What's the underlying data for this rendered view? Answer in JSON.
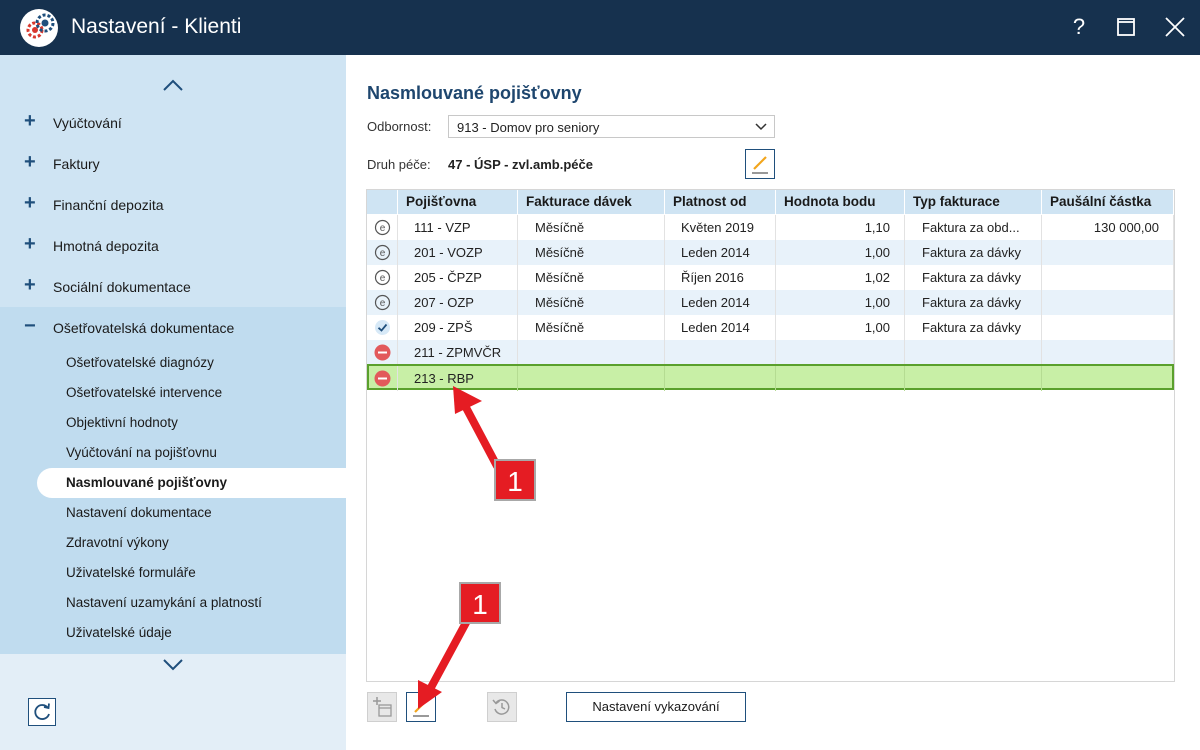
{
  "window": {
    "title": "Nastavení - Klienti",
    "help": "?",
    "colors": {
      "titlebar": "#16314e",
      "sidebar": "#cfe4f3",
      "accent": "#1f4f7c",
      "selected_row": "#c8efa6"
    }
  },
  "sidebar": {
    "top_items": [
      {
        "label": "Vyúčtování",
        "icon": "plus-icon"
      },
      {
        "label": "Faktury",
        "icon": "plus-icon"
      },
      {
        "label": "Finanční depozita",
        "icon": "plus-icon"
      },
      {
        "label": "Hmotná depozita",
        "icon": "plus-icon"
      },
      {
        "label": "Sociální dokumentace",
        "icon": "plus-icon"
      }
    ],
    "open_item": {
      "label": "Ošetřovatelská dokumentace",
      "icon": "minus-icon"
    },
    "sub_items": [
      {
        "label": "Ošetřovatelské diagnózy"
      },
      {
        "label": "Ošetřovatelské intervence"
      },
      {
        "label": "Objektivní hodnoty"
      },
      {
        "label": "Vyúčtování na pojišťovnu"
      },
      {
        "label": "Nasmlouvané pojišťovny",
        "active": true
      },
      {
        "label": "Nastavení dokumentace"
      },
      {
        "label": "Zdravotní výkony"
      },
      {
        "label": "Uživatelské formuláře"
      },
      {
        "label": "Nastavení uzamykání a platností"
      },
      {
        "label": "Uživatelské údaje"
      }
    ]
  },
  "main": {
    "heading": "Nasmlouvané pojišťovny",
    "odbornost_label": "Odbornost:",
    "odbornost_value": "913 - Domov pro seniory",
    "druh_label": "Druh péče:",
    "druh_value": "47 - ÚSP - zvl.amb.péče",
    "table": {
      "columns": [
        "Pojišťovna",
        "Fakturace dávek",
        "Platnost od",
        "Hodnota bodu",
        "Typ fakturace",
        "Paušální částka"
      ],
      "rows": [
        {
          "status": "e-icon",
          "pojistovna": "111 - VZP",
          "fakturace": "Měsíčně",
          "platnost": "Květen 2019",
          "hodnota": "1,10",
          "typ": "Faktura za obd...",
          "pausal": "130 000,00"
        },
        {
          "status": "e-icon",
          "pojistovna": "201 - VOZP",
          "fakturace": "Měsíčně",
          "platnost": "Leden 2014",
          "hodnota": "1,00",
          "typ": "Faktura za dávky",
          "pausal": ""
        },
        {
          "status": "e-icon",
          "pojistovna": "205 - ČPZP",
          "fakturace": "Měsíčně",
          "platnost": "Říjen 2016",
          "hodnota": "1,02",
          "typ": "Faktura za dávky",
          "pausal": ""
        },
        {
          "status": "e-icon",
          "pojistovna": "207 - OZP",
          "fakturace": "Měsíčně",
          "platnost": "Leden 2014",
          "hodnota": "1,00",
          "typ": "Faktura za dávky",
          "pausal": ""
        },
        {
          "status": "check-icon",
          "pojistovna": "209 - ZPŠ",
          "fakturace": "Měsíčně",
          "platnost": "Leden 2014",
          "hodnota": "1,00",
          "typ": "Faktura za dávky",
          "pausal": ""
        },
        {
          "status": "minus-circle-icon",
          "pojistovna": "211 - ZPMVČR",
          "fakturace": "",
          "platnost": "",
          "hodnota": "",
          "typ": "",
          "pausal": ""
        },
        {
          "status": "minus-circle-icon",
          "pojistovna": "213 - RBP",
          "fakturace": "",
          "platnost": "",
          "hodnota": "",
          "typ": "",
          "pausal": "",
          "selected": true
        }
      ]
    },
    "toolbar": {
      "add_icon": "add-calendar-icon",
      "edit_icon": "pencil-icon",
      "history_icon": "history-icon",
      "nastaveni_label": "Nastavení vykazování"
    }
  },
  "annotations": {
    "badge_1": "1",
    "badge_2": "1"
  }
}
